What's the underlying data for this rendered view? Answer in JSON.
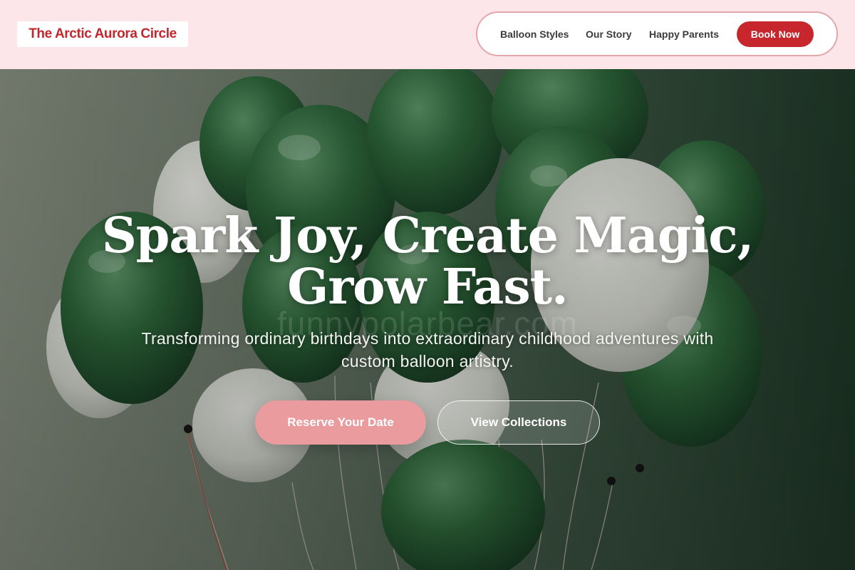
{
  "header": {
    "brand": "The Arctic Aurora Circle",
    "nav": [
      {
        "label": "Balloon Styles"
      },
      {
        "label": "Our Story"
      },
      {
        "label": "Happy Parents"
      }
    ],
    "cta_label": "Book Now"
  },
  "hero": {
    "headline_line1": "Spark Joy, Create Magic,",
    "headline_line2": "Grow Fast.",
    "watermark": "funnypolarbear.com",
    "subtitle_line1": "Transforming ordinary birthdays into extraordinary childhood adventures with",
    "subtitle_line2": "custom balloon artistry.",
    "primary_cta": "Reserve Your Date",
    "secondary_cta": "View Collections",
    "image_subject": "bunch of green and white balloons"
  },
  "colors": {
    "header_bg": "#fde6ea",
    "brand_red": "#c4262e",
    "book_button": "#c8262d",
    "nav_border": "#e3a6ab",
    "primary_cta": "#e99b9e",
    "balloon_green": "#2f6a3c",
    "balloon_white": "#e4e6df"
  }
}
